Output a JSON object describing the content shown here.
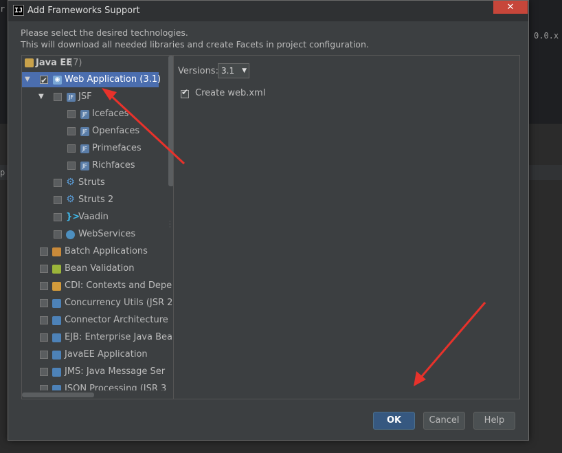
{
  "background": {
    "code_right": "0.0.x",
    "code_left_1": "r",
    "code_left_2": "p"
  },
  "dialog": {
    "title": "Add Frameworks Support",
    "close_label": "✕",
    "description_line1": "Please select the desired technologies.",
    "description_line2": "This will download all needed libraries and create Facets in project configuration."
  },
  "tree": {
    "group_label": "Java EE",
    "group_count": "(7)",
    "items": [
      {
        "label": "Web Application (3.1)",
        "checked": true,
        "selected": true
      },
      {
        "label": "JSF"
      },
      {
        "label": "Icefaces"
      },
      {
        "label": "Openfaces"
      },
      {
        "label": "Primefaces"
      },
      {
        "label": "Richfaces"
      },
      {
        "label": "Struts"
      },
      {
        "label": "Struts 2"
      },
      {
        "label": "Vaadin"
      },
      {
        "label": "WebServices"
      },
      {
        "label": "Batch Applications"
      },
      {
        "label": "Bean Validation"
      },
      {
        "label": "CDI: Contexts and Depe"
      },
      {
        "label": "Concurrency Utils (JSR 2"
      },
      {
        "label": "Connector Architecture"
      },
      {
        "label": "EJB: Enterprise Java Bea"
      },
      {
        "label": "JavaEE Application"
      },
      {
        "label": "JMS: Java Message Ser"
      },
      {
        "label": "JSON Processing (JSR 3"
      }
    ]
  },
  "config": {
    "versions_label": "Versions:",
    "versions_value": "3.1",
    "create_webxml_label": "Create web.xml",
    "create_webxml_checked": true
  },
  "buttons": {
    "ok": "OK",
    "cancel": "Cancel",
    "help": "Help"
  },
  "colors": {
    "dialog_bg": "#3c3f41",
    "selection": "#4b6eaf",
    "ok_button": "#365880",
    "annotation_arrow": "#e8322b"
  },
  "icons": [
    "intellij-icon",
    "java-ee-group-icon",
    "web-application-icon",
    "jsf-icon",
    "struts-gear-icon",
    "vaadin-icon",
    "webservices-icon",
    "batch-icon",
    "bean-validation-icon",
    "cdi-icon",
    "javaee-module-icon"
  ]
}
